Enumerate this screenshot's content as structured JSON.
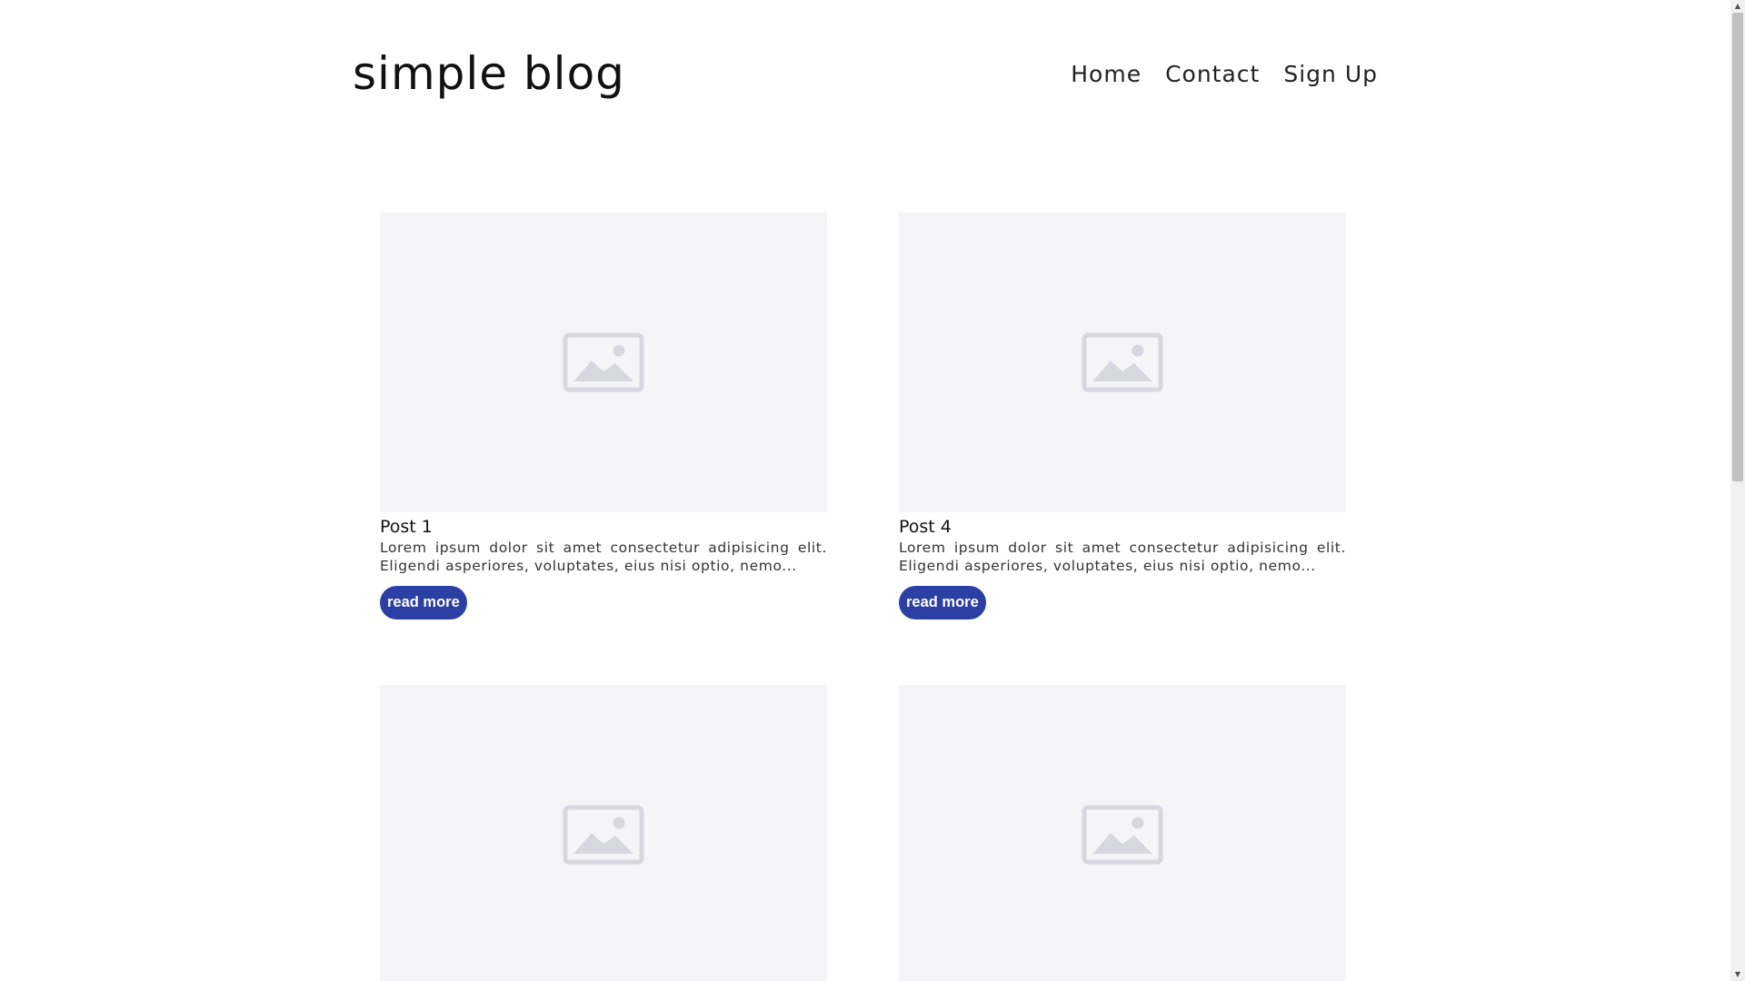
{
  "header": {
    "site_title": "simple blog",
    "nav": [
      "Home",
      "Contact",
      "Sign Up"
    ]
  },
  "posts": [
    {
      "title": "Post 1",
      "excerpt": "Lorem ipsum dolor sit amet consectetur adipisicing elit. Eligendi asperiores, voluptates, eius nisi optio, nemo...",
      "button_label": "read more",
      "image_icon": "image-placeholder-icon"
    },
    {
      "title": "Post 4",
      "excerpt": "Lorem ipsum dolor sit amet consectetur adipisicing elit. Eligendi asperiores, voluptates, eius nisi optio, nemo...",
      "button_label": "read more",
      "image_icon": "image-placeholder-icon"
    },
    {
      "image_icon": "image-placeholder-icon"
    },
    {
      "image_icon": "image-placeholder-icon"
    }
  ],
  "colors": {
    "accent": "#2b3fa4",
    "thumbnail_bg": "#f5f5f7",
    "placeholder_icon": "#d7d8df"
  }
}
